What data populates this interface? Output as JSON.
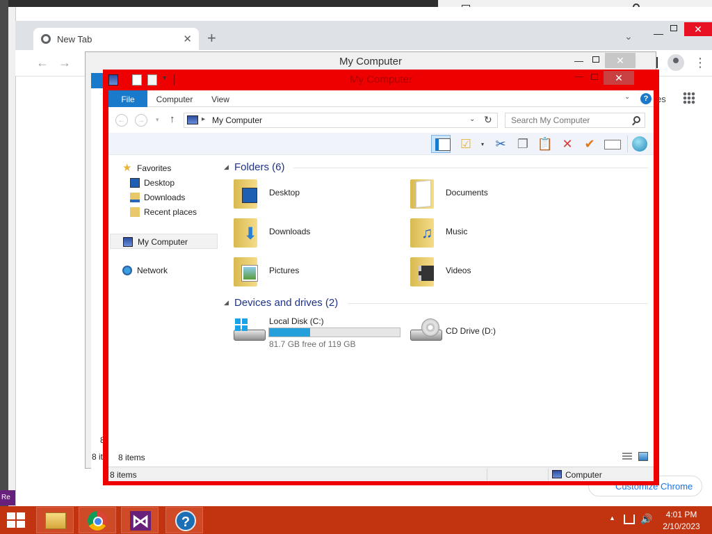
{
  "chrome": {
    "tab_title": "New Tab",
    "new_tab": "+",
    "tab_close": "✕",
    "tab_menu": "⌄",
    "back": "←",
    "forward": "→",
    "apps_label_partial": "es",
    "customize_label": "Customize Chrome",
    "menu": "⋮"
  },
  "back_window": {
    "title": "My Computer",
    "status_partial": "8 it",
    "status_partial2": "8"
  },
  "window": {
    "title": "My Computer",
    "minimize": "—",
    "close": "✕"
  },
  "ribbon": {
    "tabs": [
      "File",
      "Computer",
      "View"
    ],
    "help": "?"
  },
  "address": {
    "path": "My Computer",
    "search_placeholder": "Search My Computer"
  },
  "toolbar": {
    "cut": "✂",
    "copy": "❐",
    "paste": "📋",
    "delete": "✕",
    "check": "✔",
    "select": "☑"
  },
  "navigation": {
    "favorites": "Favorites",
    "desktop": "Desktop",
    "downloads": "Downloads",
    "recent_places": "Recent places",
    "my_computer": "My Computer",
    "network": "Network"
  },
  "folders_group": {
    "title": "Folders (6)",
    "items": [
      "Desktop",
      "Documents",
      "Downloads",
      "Music",
      "Pictures",
      "Videos"
    ]
  },
  "devices_group": {
    "title": "Devices and drives (2)",
    "local_disk": {
      "name": "Local Disk (C:)",
      "free_text": "81.7 GB free of 119 GB",
      "used_fraction": 0.3134
    },
    "cd_drive": {
      "name": "CD Drive (D:)"
    }
  },
  "status": {
    "item_count": "8 items",
    "location": "Computer"
  },
  "taskbar": {
    "time": "4:01 PM",
    "date": "2/10/2023",
    "help_glyph": "?",
    "vs_glyph": "⋈"
  },
  "colors": {
    "window_frame": "#ee0000",
    "accent": "#1979ca",
    "taskbar": "#c2330f",
    "drive_bar": "#26a0da"
  },
  "icons": [
    "chrome-icon",
    "folder-icon",
    "computer-icon",
    "search-icon",
    "cut-icon",
    "copy-icon",
    "paste-icon",
    "delete-icon",
    "check-icon",
    "globe-icon",
    "star-icon",
    "network-icon",
    "hdd-icon",
    "cd-drive-icon",
    "start-icon",
    "visual-studio-icon",
    "help-icon"
  ]
}
